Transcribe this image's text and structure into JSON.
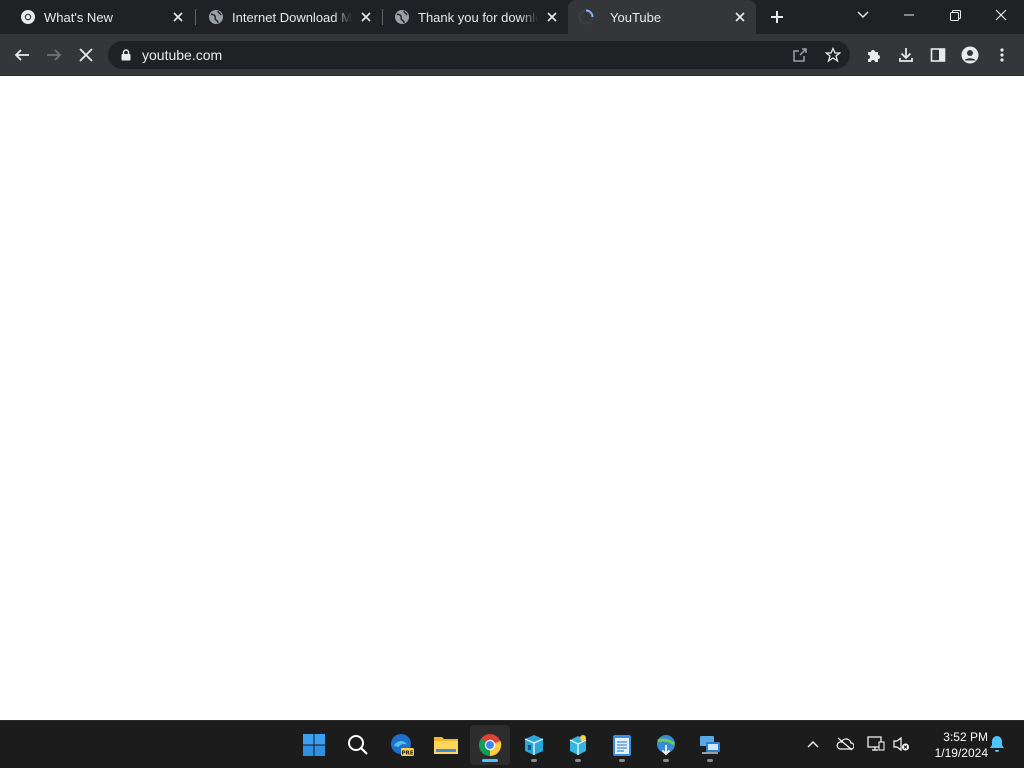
{
  "browser": {
    "tabs": [
      {
        "title": "What's New",
        "icon": "chrome-icon",
        "active": false
      },
      {
        "title": "Internet Download Ma",
        "icon": "globe-icon",
        "active": false
      },
      {
        "title": "Thank you for downlo",
        "icon": "globe-icon",
        "active": false
      },
      {
        "title": "YouTube",
        "icon": "loading-spinner-icon",
        "active": true
      }
    ],
    "address": {
      "url": "youtube.com"
    },
    "colors": {
      "tabstrip": "#202124",
      "toolbar": "#35363a",
      "omnibox": "#202124",
      "text": "#e8eaed"
    }
  },
  "taskbar": {
    "apps": [
      "windows-start-icon",
      "search-icon",
      "edge-beta-icon",
      "file-explorer-icon",
      "chrome-icon",
      "app-cube-icon",
      "app-cube2-icon",
      "notepad-icon",
      "internet-download-manager-icon",
      "network-app-icon"
    ],
    "tray": [
      "chevron-up-icon",
      "onedrive-offline-icon",
      "display-network-icon",
      "volume-mute-icon",
      "notifications-icon"
    ],
    "clock": {
      "time": "3:52 PM",
      "date": "1/19/2024"
    }
  }
}
